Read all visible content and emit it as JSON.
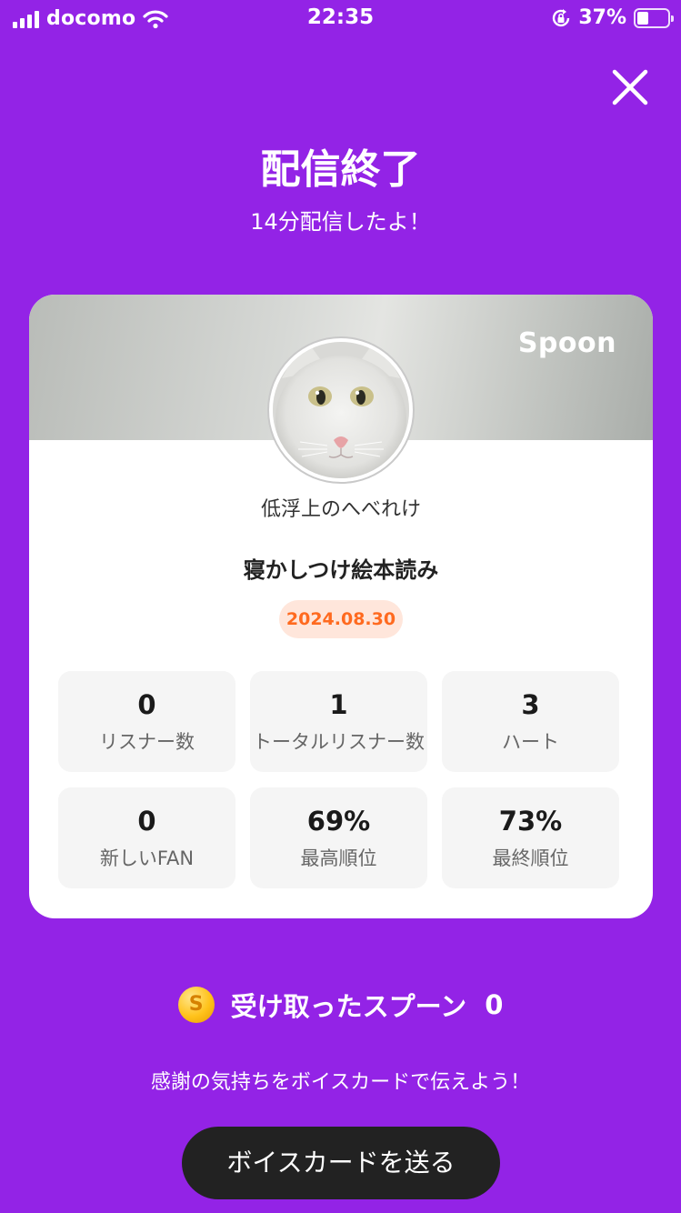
{
  "status_bar": {
    "carrier": "docomo",
    "time": "22:35",
    "battery_percent": "37%",
    "battery_level": 0.37
  },
  "header": {
    "close_icon": "close-icon",
    "title": "配信終了",
    "subtitle": "14分配信したよ！"
  },
  "card": {
    "brand": "Spoon",
    "nickname": "低浮上のへべれけ",
    "live_title": "寝かしつけ絵本読み",
    "date": "2024.08.30",
    "stats": [
      {
        "value": "0",
        "label": "リスナー数"
      },
      {
        "value": "1",
        "label": "トータルリスナー数"
      },
      {
        "value": "3",
        "label": "ハート"
      },
      {
        "value": "0",
        "label": "新しいFAN"
      },
      {
        "value": "69%",
        "label": "最高順位"
      },
      {
        "value": "73%",
        "label": "最終順位"
      }
    ]
  },
  "spoons": {
    "coin_symbol": "S",
    "label": "受け取ったスプーン",
    "count": "0"
  },
  "thanks_text": "感謝の気持ちをボイスカードで伝えよう！",
  "send_button_label": "ボイスカードを送る",
  "colors": {
    "background": "#9323E6",
    "date_badge_bg": "#FFE6DB",
    "date_badge_text": "#FF6A1F",
    "button_bg": "#222222"
  }
}
